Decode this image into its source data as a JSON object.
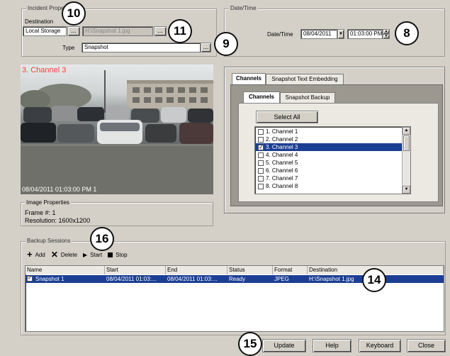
{
  "incident": {
    "group_title": "Incident Prope",
    "destination_label": "Destination",
    "destination_value": "Local Storage",
    "browse_label": "...",
    "path_value": "H:\\Snapshot 1.jpg",
    "type_label": "Type",
    "type_value": "Snapshot"
  },
  "datetime": {
    "group_title": "Date/Time",
    "label": "Date/Time",
    "date_value": "08/04/2011",
    "time_value": "01:03:00 PM"
  },
  "camera": {
    "title": "3. Channel 3",
    "timestamp": "08/04/2011 01:03:00 PM 1"
  },
  "image_properties": {
    "title": "Image Properties",
    "frame": "Frame #: 1",
    "resolution": "Resolution: 1600x1200"
  },
  "channels_panel": {
    "outer_tabs": [
      "Channels",
      "Snapshot Text Embedding"
    ],
    "inner_tabs": [
      "Channels",
      "Snapshot Backup"
    ],
    "select_all": "Select All",
    "channels": [
      {
        "label": "1. Channel 1",
        "checked": false,
        "selected": false
      },
      {
        "label": "2. Channel 2",
        "checked": false,
        "selected": false
      },
      {
        "label": "3. Channel 3",
        "checked": true,
        "selected": true
      },
      {
        "label": "4. Channel 4",
        "checked": false,
        "selected": false
      },
      {
        "label": "5. Channel 5",
        "checked": false,
        "selected": false
      },
      {
        "label": "6. Channel 6",
        "checked": false,
        "selected": false
      },
      {
        "label": "7. Channel 7",
        "checked": false,
        "selected": false
      },
      {
        "label": "8. Channel 8",
        "checked": false,
        "selected": false
      }
    ]
  },
  "backup": {
    "group_title": "Backup Sessions",
    "toolbar": {
      "add": "Add",
      "delete": "Delete",
      "start": "Start",
      "stop": "Stop"
    },
    "columns": [
      "Name",
      "Start",
      "End",
      "Status",
      "Format",
      "Destination"
    ],
    "rows": [
      {
        "name": "Snapshot 1",
        "start": "08/04/2011 01:03:...",
        "end": "08/04/2011 01:03:...",
        "status": "Ready",
        "format": "JPEG",
        "destination": "H:\\Snapshot 1.jpg",
        "checked": true
      }
    ]
  },
  "footer": {
    "update": "Update",
    "help": "Help",
    "keyboard": "Keyboard",
    "close": "Close"
  },
  "callouts": {
    "c8": "8",
    "c9": "9",
    "c10": "10",
    "c11": "11",
    "c14": "14",
    "c15": "15",
    "c16": "16"
  },
  "colors": {
    "selection": "#1c3f94",
    "timestamp_red": "#ff3b3b",
    "window_bg": "#d4d0c8"
  }
}
